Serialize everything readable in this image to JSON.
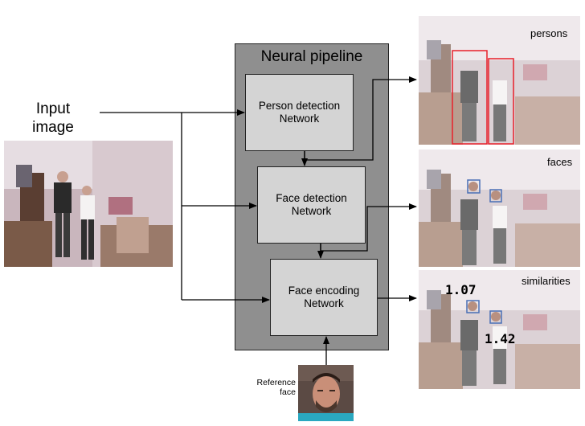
{
  "input": {
    "label_line1": "Input",
    "label_line2": "image"
  },
  "pipeline": {
    "title": "Neural pipeline",
    "person_detection": {
      "line1": "Person detection",
      "line2": "Network"
    },
    "face_detection": {
      "line1": "Face detection",
      "line2": "Network"
    },
    "face_encoding": {
      "line1": "Face encoding",
      "line2": "Network"
    }
  },
  "outputs": {
    "persons": "persons",
    "faces": "faces",
    "similarities": "similarities",
    "similarity_1": "1.07",
    "similarity_2": "1.42"
  },
  "reference": {
    "line1": "Reference",
    "line2": "face"
  },
  "colors": {
    "pipeline_bg": "#8f8f8f",
    "network_bg": "#d4d4d4",
    "person_box": "#e8202a",
    "face_box": "#4a6fb5"
  }
}
